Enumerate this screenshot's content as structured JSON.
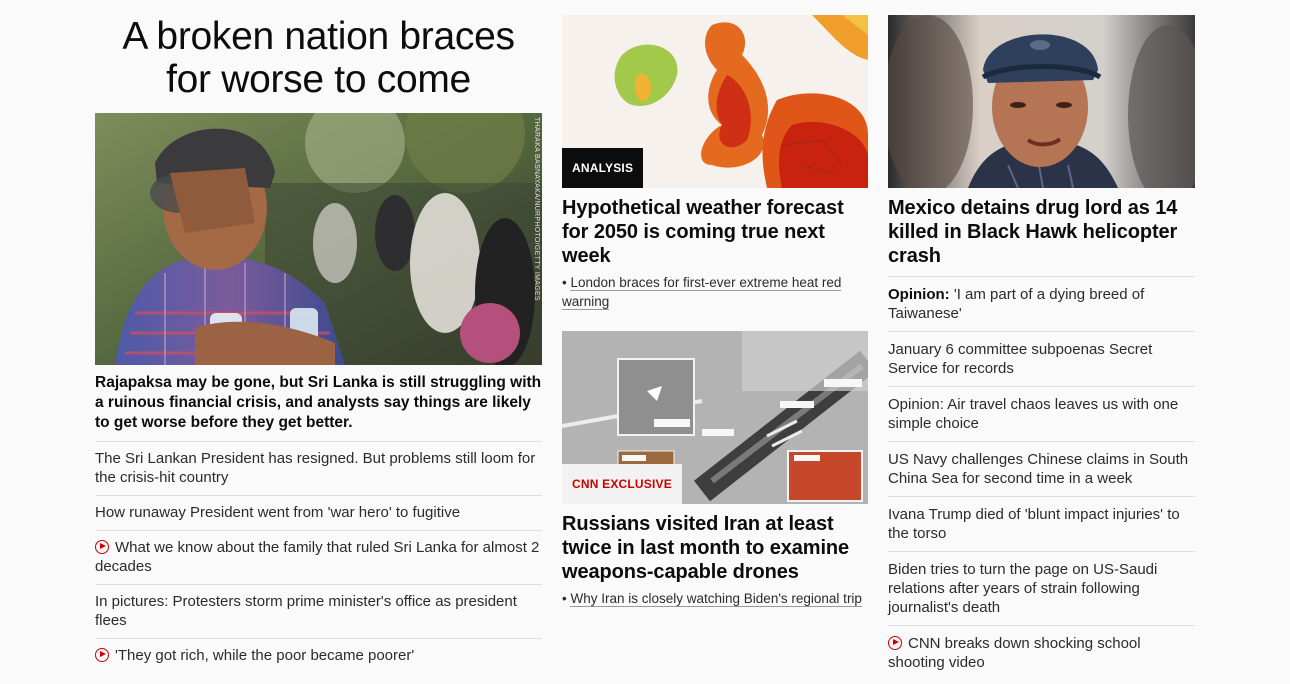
{
  "lead": {
    "headline": "A broken nation braces for worse to come",
    "image_credit": "THARAKA BASNAYAKA/NURPHOTO/GETTY IMAGES",
    "deck": "Rajapaksa may be gone, but Sri Lanka is still struggling with a ruinous financial crisis, and analysts say things are likely to get worse before they get better.",
    "links": [
      {
        "text": "The Sri Lankan President has resigned. But problems still loom for the crisis-hit country",
        "video": false
      },
      {
        "text": "How runaway President went from 'war hero' to fugitive",
        "video": false
      },
      {
        "text": "What we know about the family that ruled Sri Lanka for almost 2 decades",
        "video": true
      },
      {
        "text": "In pictures: Protesters storm prime minister's office as president flees",
        "video": false
      },
      {
        "text": "'They got rich, while the poor became poorer'",
        "video": true
      }
    ]
  },
  "middle": {
    "card1": {
      "badge": "ANALYSIS",
      "title": "Hypothetical weather forecast for 2050 is coming true next week",
      "bullet": "London braces for first-ever extreme heat red warning"
    },
    "card2": {
      "badge": "CNN EXCLUSIVE",
      "title": "Russians visited Iran at least twice in last month to examine weapons-capable drones",
      "bullet": "Why Iran is closely watching Biden's regional trip"
    }
  },
  "right": {
    "title": "Mexico detains drug lord as 14 killed in Black Hawk helicopter crash",
    "links": [
      {
        "label": "Opinion:",
        "text": " 'I am part of a dying breed of Taiwanese'",
        "video": false
      },
      {
        "label": "",
        "text": "January 6 committee subpoenas Secret Service for records",
        "video": false
      },
      {
        "label": "",
        "text": "Opinion: Air travel chaos leaves us with one simple choice",
        "video": false
      },
      {
        "label": "",
        "text": "US Navy challenges Chinese claims in South China Sea for second time in a week",
        "video": false
      },
      {
        "label": "",
        "text": "Ivana Trump died of 'blunt impact injuries' to the torso",
        "video": false
      },
      {
        "label": "",
        "text": "Biden tries to turn the page on US-Saudi relations after years of strain following journalist's death",
        "video": false
      },
      {
        "label": "",
        "text": "CNN breaks down shocking school shooting video",
        "video": true
      }
    ]
  },
  "colors": {
    "accent_red": "#cc0000",
    "badge_dark": "#0c0c0c"
  }
}
